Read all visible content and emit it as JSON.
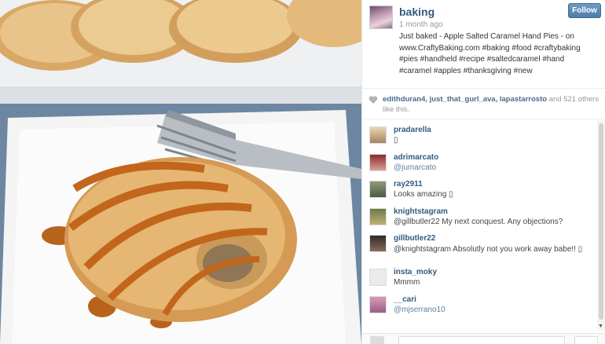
{
  "photo": {
    "description_icon": "photo"
  },
  "post": {
    "username": "baking",
    "follow_label": "Follow",
    "time": "1 month ago",
    "caption": "Just baked - Apple Salted Caramel Hand Pies - on www.CraftyBaking.com #baking #food #craftybaking #pies #handheld #recipe #saltedcaramel #hand #caramel #apples #thanksgiving #new"
  },
  "likes": {
    "users": "edithduran4, just_that_gurl_ava, lapastarrosto",
    "and": "and",
    "count_text": "521 others like this."
  },
  "comments": [
    {
      "user": "pradarella",
      "text": "▯",
      "mention": false
    },
    {
      "user": "adrimarcato",
      "text": "@jumarcato",
      "mention": true
    },
    {
      "user": "ray2911",
      "text": "Looks amazing ▯",
      "mention": false
    },
    {
      "user": "knightstagram",
      "text": "@gillbutler22 My next conquest. Any objections?",
      "mention": false
    },
    {
      "user": "gillbutler22",
      "text": "@knightstagram Absolutly not you work away babe!! ▯",
      "mention": false
    },
    {
      "user": "insta_moky",
      "text": "Mmmm",
      "mention": false
    },
    {
      "user": "__cari",
      "text": "@mjserrano10",
      "mention": true
    }
  ],
  "colors": {
    "link": "#335a7f",
    "follow_bg": "#5a87b2"
  }
}
